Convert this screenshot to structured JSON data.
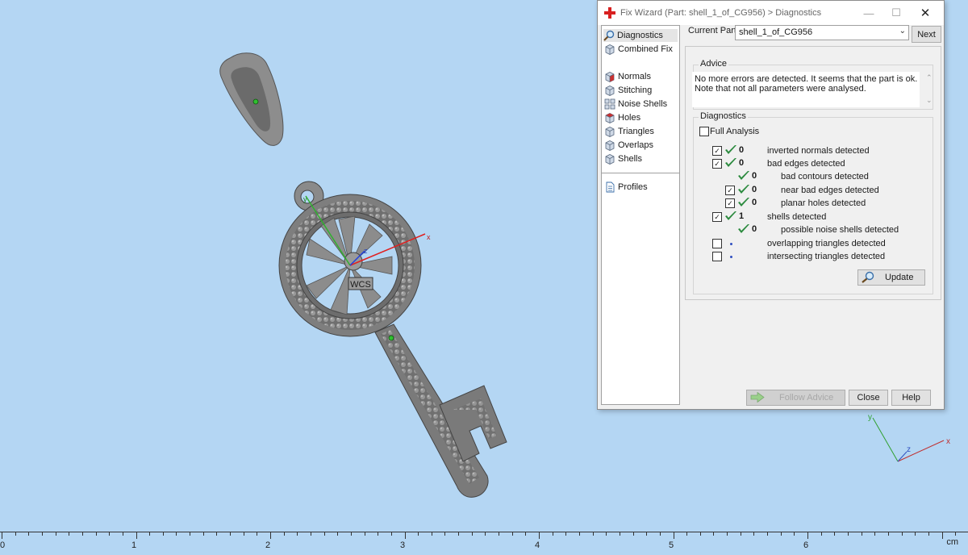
{
  "dialog": {
    "title": "Fix Wizard (Part: shell_1_of_CG956) > Diagnostics",
    "nav": {
      "items": [
        {
          "label": "Diagnostics",
          "icon": "magnifier-icon",
          "selected": true
        },
        {
          "label": "Combined Fix",
          "icon": "cube-icon"
        },
        {
          "label": "Normals",
          "icon": "cube-red-icon"
        },
        {
          "label": "Stitching",
          "icon": "cube-icon"
        },
        {
          "label": "Noise Shells",
          "icon": "noise-shells-icon"
        },
        {
          "label": "Holes",
          "icon": "cube-red-icon"
        },
        {
          "label": "Triangles",
          "icon": "cube-icon"
        },
        {
          "label": "Overlaps",
          "icon": "cube-icon"
        },
        {
          "label": "Shells",
          "icon": "cube-icon"
        },
        {
          "label": "Profiles",
          "icon": "document-icon"
        }
      ]
    },
    "current_part_label": "Current Part:",
    "current_part_value": "shell_1_of_CG956",
    "next_label": "Next",
    "advice": {
      "title": "Advice",
      "text": "No more errors are detected. It seems that the part is ok. Note that not all parameters were analysed."
    },
    "diagnostics": {
      "title": "Diagnostics",
      "full_analysis_label": "Full Analysis",
      "full_analysis_checked": false,
      "rows": [
        {
          "checked": true,
          "count": "0",
          "label": "inverted normals detected",
          "status": "ok"
        },
        {
          "checked": true,
          "count": "0",
          "label": "bad edges detected",
          "status": "ok"
        },
        {
          "checked": null,
          "count": "0",
          "label": "bad contours detected",
          "status": "ok"
        },
        {
          "checked": true,
          "count": "0",
          "label": "near bad edges detected",
          "status": "ok"
        },
        {
          "checked": true,
          "count": "0",
          "label": "planar holes detected",
          "status": "ok"
        },
        {
          "checked": true,
          "count": "1",
          "label": "shells detected",
          "status": "ok"
        },
        {
          "checked": null,
          "count": "0",
          "label": "possible noise shells detected",
          "status": "ok"
        },
        {
          "checked": false,
          "count": "",
          "label": "overlapping triangles detected",
          "status": "pending"
        },
        {
          "checked": false,
          "count": "",
          "label": "intersecting triangles detected",
          "status": "pending"
        }
      ],
      "update_label": "Update"
    },
    "buttons": {
      "follow_advice": "Follow Advice",
      "close": "Close",
      "help": "Help"
    }
  },
  "viewport": {
    "wcs_label": "WCS",
    "axis_x": "x",
    "axis_y": "y",
    "axis_z": "z",
    "background_color": "#b4d6f3"
  },
  "ruler": {
    "labels": [
      "0",
      "1",
      "2",
      "3",
      "4",
      "5",
      "6"
    ],
    "unit": "cm"
  }
}
